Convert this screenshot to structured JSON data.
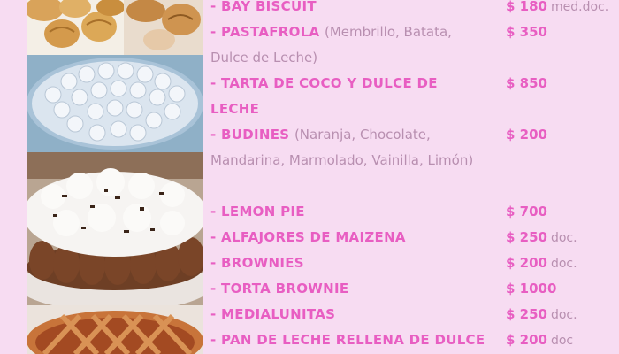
{
  "menu": {
    "items": [
      {
        "name": "- BAY BISCUIT",
        "detail": "",
        "price": "$ 180",
        "unit": "med.doc."
      },
      {
        "name": "- PASTAFROLA",
        "detail": "(Membrillo, Batata, Dulce de Leche)",
        "price": "$ 350",
        "unit": ""
      },
      {
        "name": "- TARTA DE COCO Y DULCE DE LECHE",
        "detail": "",
        "price": "$ 850",
        "unit": ""
      },
      {
        "name": "- BUDINES",
        "detail": "(Naranja, Chocolate, Mandarina, Marmolado, Vainilla, Limón)",
        "price": "$ 200",
        "unit": ""
      },
      {
        "name": "- LEMON PIE",
        "detail": "",
        "price": "$ 700",
        "unit": ""
      },
      {
        "name": "- ALFAJORES DE MAIZENA",
        "detail": "",
        "price": "$ 250",
        "unit": "doc."
      },
      {
        "name": "- BROWNIES",
        "detail": "",
        "price": "$ 200",
        "unit": "doc."
      },
      {
        "name": "- TORTA BROWNIE",
        "detail": "",
        "price": "$ 1000",
        "unit": ""
      },
      {
        "name": "- MEDIALUNITAS",
        "detail": "",
        "price": "$ 250",
        "unit": "doc."
      },
      {
        "name": "- PAN DE LECHE RELLENA DE DULCE",
        "detail": "",
        "price": "$ 200",
        "unit": "doc"
      }
    ]
  },
  "colors": {
    "background": "#f7dcf2",
    "accent": "#e85ec2",
    "detail_text": "#b88fb0"
  },
  "photos": {
    "items": [
      "croissants",
      "meringue-pie",
      "chocolate-cream-cake",
      "lattice-pastafrola"
    ]
  }
}
